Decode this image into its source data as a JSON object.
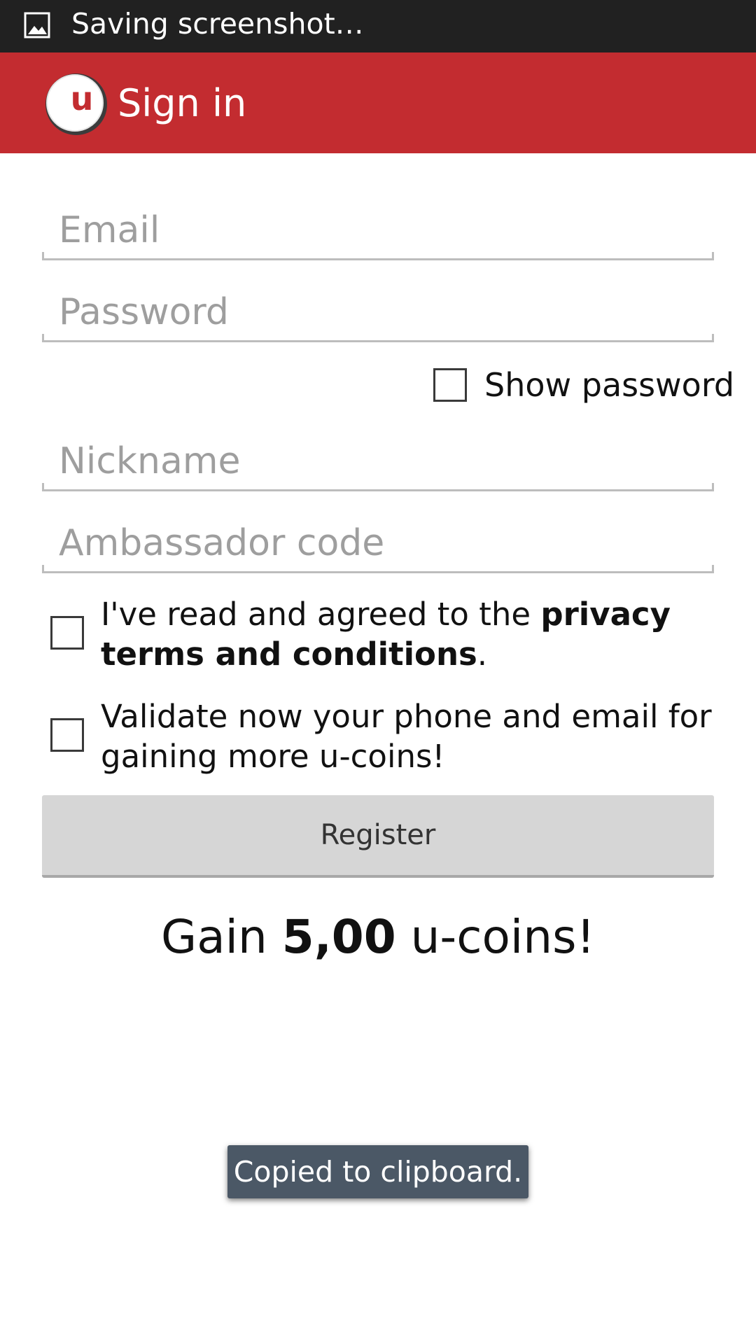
{
  "status_bar": {
    "notification_text": "Saving screenshot…",
    "icon": "picture-icon"
  },
  "app_bar": {
    "title": "Sign in",
    "logo_letter": "u",
    "color": "#c32c30"
  },
  "form": {
    "email_placeholder": "Email",
    "password_placeholder": "Password",
    "show_password_label": "Show password",
    "nickname_placeholder": "Nickname",
    "ambassador_placeholder": "Ambassador code",
    "privacy_consent": {
      "prefix": "I've read and agreed to the ",
      "link": "privacy terms and conditions",
      "suffix": "."
    },
    "validate_label": "Validate now your phone and email for gaining more u-coins!",
    "register_label": "Register"
  },
  "reward": {
    "prefix": "Gain ",
    "amount": "5,00",
    "suffix": " u-coins!"
  },
  "toast": {
    "message": "Copied to clipboard."
  }
}
